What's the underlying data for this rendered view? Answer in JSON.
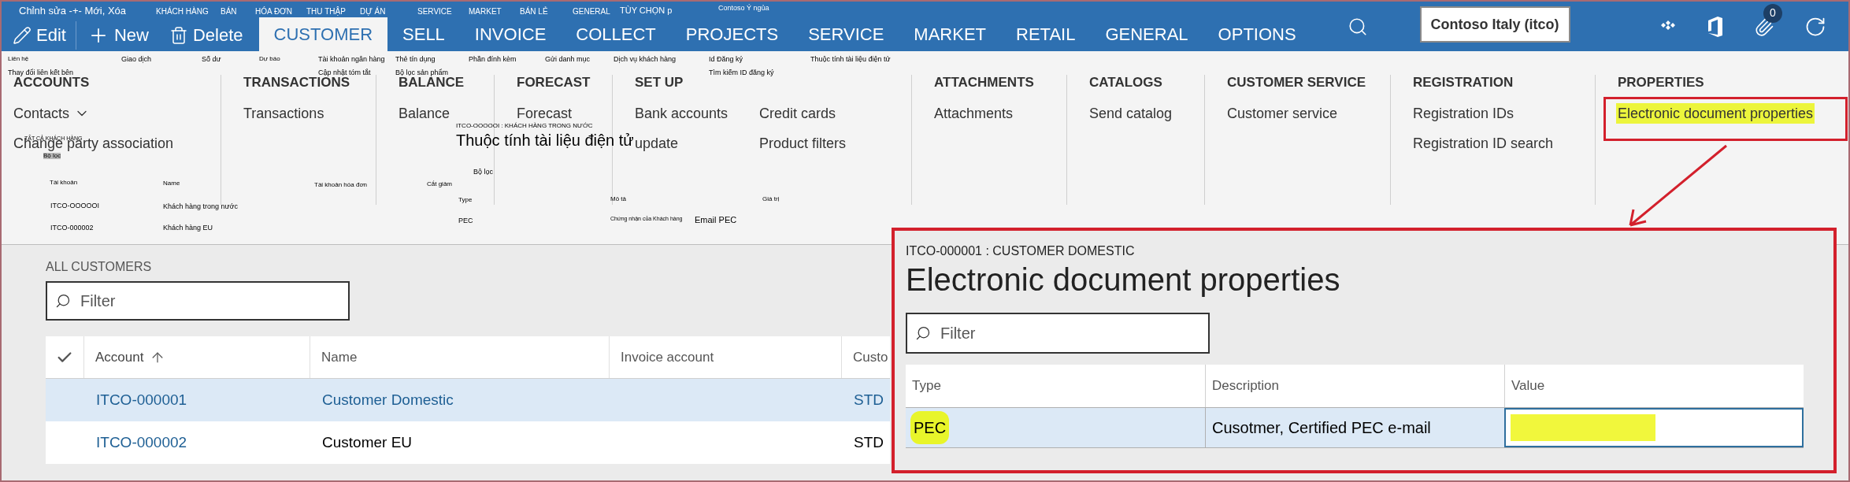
{
  "app_bar": {
    "actions": [
      {
        "label": "Edit",
        "kind": "edit"
      },
      {
        "label": "New",
        "kind": "new"
      },
      {
        "label": "Delete",
        "kind": "delete"
      }
    ],
    "tabs": [
      {
        "label": "CUSTOMER",
        "selected": true
      },
      {
        "label": "SELL",
        "selected": false
      },
      {
        "label": "INVOICE",
        "selected": false
      },
      {
        "label": "COLLECT",
        "selected": false
      },
      {
        "label": "PROJECTS",
        "selected": false
      },
      {
        "label": "SERVICE",
        "selected": false
      },
      {
        "label": "MARKET",
        "selected": false
      },
      {
        "label": "RETAIL",
        "selected": false
      },
      {
        "label": "GENERAL",
        "selected": false
      },
      {
        "label": "OPTIONS",
        "selected": false
      }
    ],
    "company": "Contoso Italy (itco)",
    "notification_count": "0"
  },
  "ribbon": {
    "groups": [
      {
        "title": "ACCOUNTS",
        "columns": [
          [
            {
              "label": "Contacts",
              "dropdown": true,
              "highlighted": false
            },
            {
              "label": "Change party association",
              "dropdown": false,
              "highlighted": false
            }
          ]
        ]
      },
      {
        "title": "TRANSACTIONS",
        "columns": [
          [
            {
              "label": "Transactions",
              "dropdown": false,
              "highlighted": false
            }
          ]
        ]
      },
      {
        "title": "BALANCE",
        "columns": [
          [
            {
              "label": "Balance",
              "dropdown": false,
              "highlighted": false
            }
          ]
        ]
      },
      {
        "title": "FORECAST",
        "columns": [
          [
            {
              "label": "Forecast",
              "dropdown": false,
              "highlighted": false
            }
          ]
        ]
      },
      {
        "title": "SET UP",
        "columns": [
          [
            {
              "label": "Bank accounts",
              "dropdown": false,
              "highlighted": false
            },
            {
              "label": "update",
              "dropdown": false,
              "highlighted": false
            }
          ],
          [
            {
              "label": "Credit cards",
              "dropdown": false,
              "highlighted": false
            },
            {
              "label": "Product filters",
              "dropdown": false,
              "highlighted": false
            }
          ]
        ]
      },
      {
        "title": "ATTACHMENTS",
        "columns": [
          [
            {
              "label": "Attachments",
              "dropdown": false,
              "highlighted": false
            }
          ]
        ]
      },
      {
        "title": "CATALOGS",
        "columns": [
          [
            {
              "label": "Send catalog",
              "dropdown": false,
              "highlighted": false
            }
          ]
        ]
      },
      {
        "title": "CUSTOMER SERVICE",
        "columns": [
          [
            {
              "label": "Customer service",
              "dropdown": false,
              "highlighted": false
            }
          ]
        ]
      },
      {
        "title": "REGISTRATION",
        "columns": [
          [
            {
              "label": "Registration IDs",
              "dropdown": false,
              "highlighted": false
            },
            {
              "label": "Registration ID search",
              "dropdown": false,
              "highlighted": false
            }
          ]
        ]
      },
      {
        "title": "PROPERTIES",
        "columns": [
          [
            {
              "label": "Electronic document properties",
              "dropdown": false,
              "highlighted": true
            }
          ]
        ]
      }
    ]
  },
  "list": {
    "title": "ALL CUSTOMERS",
    "filter_placeholder": "Filter",
    "columns": [
      {
        "label": "Account",
        "sorted": true
      },
      {
        "label": "Name",
        "sorted": false
      },
      {
        "label": "Invoice account",
        "sorted": false
      },
      {
        "label": "Custo",
        "sorted": false
      }
    ],
    "rows": [
      {
        "selected": true,
        "account": "ITCO-000001",
        "name": "Customer Domestic",
        "column_4": "STD"
      },
      {
        "selected": false,
        "account": "ITCO-000002",
        "name": "Customer EU",
        "column_4": "STD"
      }
    ]
  },
  "panel": {
    "subtitle": "ITCO-000001 : CUSTOMER DOMESTIC",
    "title": "Electronic document properties",
    "filter_placeholder": "Filter",
    "columns": [
      "Type",
      "Description",
      "Value"
    ],
    "rows": [
      {
        "selected": true,
        "type": "PEC",
        "type_highlighted": true,
        "description": "Cusotmer, Certified PEC e-mail",
        "value_highlighted": true
      }
    ]
  },
  "translation_overlay": [
    {
      "text": "Chỉnh sửa -+- Mới, Xóa"
    },
    {
      "text": "KHÁCH HÀNG"
    },
    {
      "text": "BÁN"
    },
    {
      "text": "HÓA ĐƠN"
    },
    {
      "text": "THU THẬP"
    },
    {
      "text": "DỰ ÁN"
    },
    {
      "text": "SERVICE"
    },
    {
      "text": "MARKET"
    },
    {
      "text": "BÁN LẺ"
    },
    {
      "text": "GENERAL"
    },
    {
      "text": "TÙY CHỌN p"
    },
    {
      "text": "Contoso Ý ngủa"
    },
    {
      "text": "Liên hệ"
    },
    {
      "text": "Giao dịch"
    },
    {
      "text": "Số dư"
    },
    {
      "text": "Dự báo"
    },
    {
      "text": "Tài khoản ngân hàng"
    },
    {
      "text": "Thẻ tín dụng"
    },
    {
      "text": "Phần đính kèm"
    },
    {
      "text": "Gửi danh mục"
    },
    {
      "text": "Dịch vụ khách hàng"
    },
    {
      "text": "Id Đăng ký"
    },
    {
      "text": "Thuộc tính tài liệu điện tử"
    },
    {
      "text": "Thay đổi liên kết bên"
    },
    {
      "text": "Cập nhật tóm tắt"
    },
    {
      "text": "Bộ lọc sản phẩm"
    },
    {
      "text": "Tìm kiếm ID đăng ký"
    },
    {
      "text": "TẤT CẢ KHÁCH HÀNG"
    },
    {
      "text": "Bộ lọc"
    },
    {
      "text": "ITCO-OOOOOI : KHÁCH HÀNG TRONG NƯỚC"
    },
    {
      "text": "Thuộc tính tài liệu điện tử"
    },
    {
      "text": "Bộ lọc"
    },
    {
      "text": "Tài khoản"
    },
    {
      "text": "Name"
    },
    {
      "text": "Tài khoản hóa đơn"
    },
    {
      "text": "Cắt giảm"
    },
    {
      "text": "Type"
    },
    {
      "text": "Mô tả"
    },
    {
      "text": "Giá trị"
    },
    {
      "text": "ITCO-OOOOOI"
    },
    {
      "text": "Khách hàng trong nước"
    },
    {
      "text": "PEC"
    },
    {
      "text": "Chứng nhận của Khách hàng"
    },
    {
      "text": "Email PEC"
    },
    {
      "text": "ITCO-000002"
    },
    {
      "text": "Khách hàng EU"
    }
  ]
}
